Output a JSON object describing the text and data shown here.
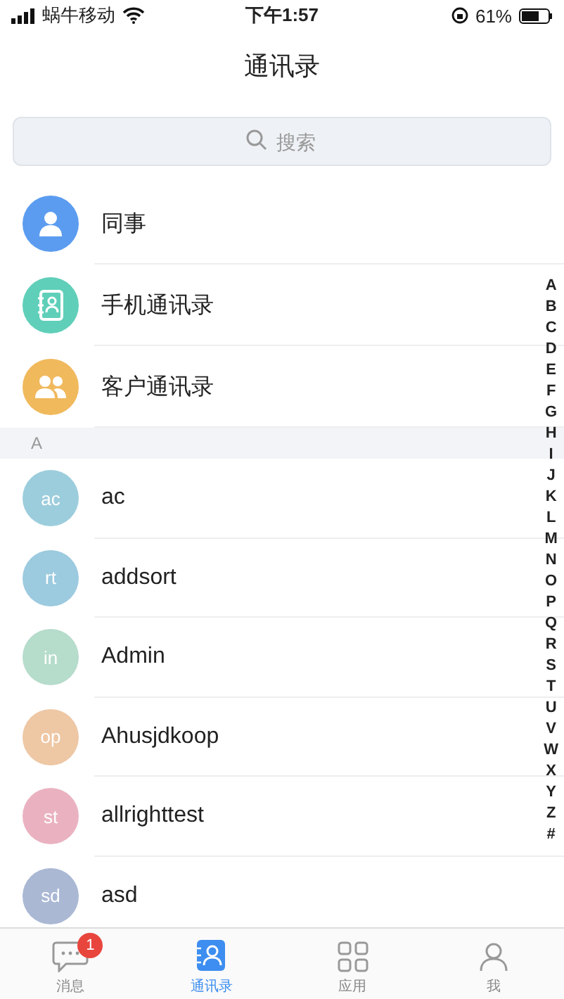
{
  "status_bar": {
    "carrier": "蜗牛移动",
    "time": "下午1:57",
    "battery": "61%"
  },
  "title": "通讯录",
  "search": {
    "placeholder": "搜索"
  },
  "shortcuts": [
    {
      "label": "同事",
      "kind": "person",
      "color": "#5b9cf0"
    },
    {
      "label": "手机通讯录",
      "kind": "contact-book",
      "color": "#5fcfb9"
    },
    {
      "label": "客户通讯录",
      "kind": "people",
      "color": "#f0b95c"
    }
  ],
  "sections": [
    {
      "letter": "A",
      "contacts": [
        {
          "initials": "ac",
          "name": "ac",
          "color": "#9ccddc"
        },
        {
          "initials": "rt",
          "name": "addsort",
          "color": "#9ccadf"
        },
        {
          "initials": "in",
          "name": "Admin",
          "color": "#b6dccb"
        },
        {
          "initials": "op",
          "name": "Ahusjdkoop",
          "color": "#eec7a4"
        },
        {
          "initials": "st",
          "name": "allrighttest",
          "color": "#eab2c0"
        },
        {
          "initials": "sd",
          "name": "asd",
          "color": "#aab8d4"
        }
      ]
    }
  ],
  "index": [
    "A",
    "B",
    "C",
    "D",
    "E",
    "F",
    "G",
    "H",
    "I",
    "J",
    "K",
    "L",
    "M",
    "N",
    "O",
    "P",
    "Q",
    "R",
    "S",
    "T",
    "U",
    "V",
    "W",
    "X",
    "Y",
    "Z",
    "#"
  ],
  "tabs": [
    {
      "label": "消息",
      "kind": "chat",
      "selected": false,
      "badge": "1"
    },
    {
      "label": "通讯录",
      "kind": "contacts",
      "selected": true
    },
    {
      "label": "应用",
      "kind": "apps",
      "selected": false
    },
    {
      "label": "我",
      "kind": "me",
      "selected": false
    }
  ]
}
